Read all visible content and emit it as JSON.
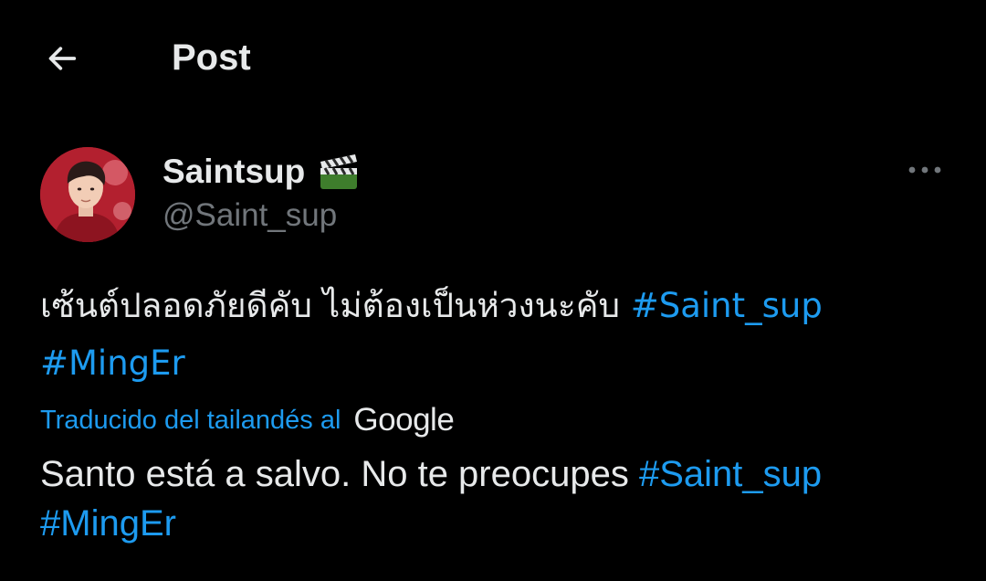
{
  "header": {
    "title": "Post",
    "back_icon": "arrow-left-icon"
  },
  "author": {
    "display_name": "Saintsup",
    "badge_icon": "clapper-board-icon",
    "handle": "@Saint_sup",
    "more_icon": "ellipsis-icon"
  },
  "tweet": {
    "text": "เซ้นต์ปลอดภัยดีคับ ไม่ต้องเป็นห่วงนะคับ",
    "hashtags": [
      "#Saint_sup",
      "#MingEr"
    ]
  },
  "translation": {
    "label": "Traducido del tailandés al",
    "provider": "Google",
    "text": "Santo está a salvo. No te preocupes",
    "hashtags": [
      "#Saint_sup",
      "#MingEr"
    ]
  },
  "colors": {
    "background": "#000000",
    "text": "#e7e9ea",
    "secondary": "#71767b",
    "link": "#1d9bf0"
  }
}
